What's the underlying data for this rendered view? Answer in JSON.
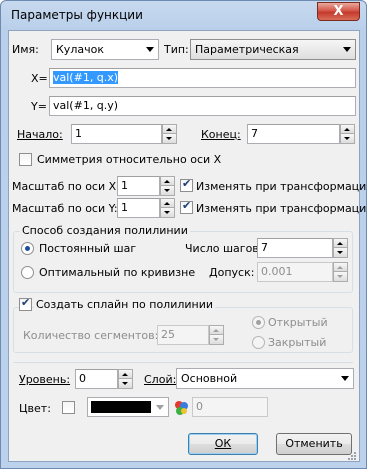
{
  "window": {
    "title": "Параметры функции",
    "close_glyph": "X"
  },
  "name": {
    "label": "Имя:",
    "value": "Кулачок"
  },
  "type": {
    "label": "Тип:",
    "value": "Параметрическая"
  },
  "x": {
    "label": "X=",
    "value": "val(#1, q.x)"
  },
  "y": {
    "label": "Y=",
    "value": "val(#1, q.y)"
  },
  "start": {
    "label": "Начало:",
    "value": "1"
  },
  "end": {
    "label": "Конец:",
    "value": "7"
  },
  "symmetry": {
    "label": "Симметрия относительно оси X",
    "checked": false
  },
  "scale_x": {
    "label": "Масштаб по оси X:",
    "value": "1",
    "transform_label": "Изменять при трансформации",
    "transform_checked": true
  },
  "scale_y": {
    "label": "Масштаб по оси Y:",
    "value": "1",
    "transform_label": "Изменять при трансформации",
    "transform_checked": true
  },
  "polyline": {
    "title": "Способ создания полилинии",
    "const_step_label": "Постоянный шаг",
    "optimal_label": "Оптимальный по кривизне",
    "steps_label": "Число шагов:",
    "steps_value": "7",
    "tolerance_label": "Допуск:",
    "tolerance_value": "0.001"
  },
  "spline": {
    "title": "Создать сплайн по полилинии",
    "checked": true,
    "segments_label": "Количество сегментов:",
    "segments_value": "25",
    "open_label": "Открытый",
    "closed_label": "Закрытый"
  },
  "level": {
    "label": "Уровень:",
    "value": "0"
  },
  "layer": {
    "label": "Слой:",
    "value": "Основной"
  },
  "color": {
    "label": "Цвет:",
    "value": "0",
    "swatch": "#000000"
  },
  "buttons": {
    "ok": "ОК",
    "cancel": "Отменить"
  }
}
